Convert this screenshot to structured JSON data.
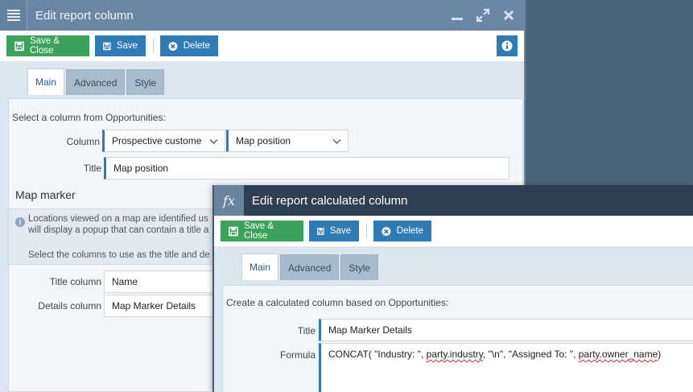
{
  "window_main": {
    "title": "Edit report column",
    "toolbar": {
      "save_close": "Save & Close",
      "save": "Save",
      "delete": "Delete"
    },
    "tabs": [
      "Main",
      "Advanced",
      "Style"
    ],
    "active_tab": "Main",
    "intro": "Select a column from Opportunities:",
    "column_label": "Column",
    "column_select_1": "Prospective custome",
    "column_select_2": "Map position",
    "title_label": "Title",
    "title_value": "Map position",
    "map_marker_heading": "Map marker",
    "info_line_1": "Locations viewed on a map are identified us",
    "info_line_2": "will display a popup that can contain a title a",
    "info_line_3": "Select the columns to use as the title and de",
    "title_column_label": "Title column",
    "title_column_value": "Name",
    "details_column_label": "Details column",
    "details_column_value": "Map Marker Details"
  },
  "window_calc": {
    "title": "Edit report calculated column",
    "fx_icon_text": "fx",
    "toolbar": {
      "save_close": "Save & Close",
      "save": "Save",
      "delete": "Delete"
    },
    "tabs": [
      "Main",
      "Advanced",
      "Style"
    ],
    "active_tab": "Main",
    "intro": "Create a calculated column based on Opportunities:",
    "title_label": "Title",
    "title_value": "Map Marker Details",
    "formula_label": "Formula",
    "formula": {
      "part1": "CONCAT( \"Industry: \",  ",
      "ref1": "party.industry",
      "part2": ", \"\\n\", \"Assigned To: \",  ",
      "ref2": "party.owner_name",
      "part3": ")"
    }
  },
  "colors": {
    "green_button": "#3aa25a",
    "blue_button": "#2f7bb5",
    "titlebar_main": "#6b86a4",
    "titlebar_calc": "#2e3f52",
    "backdrop": "#4a6478"
  }
}
